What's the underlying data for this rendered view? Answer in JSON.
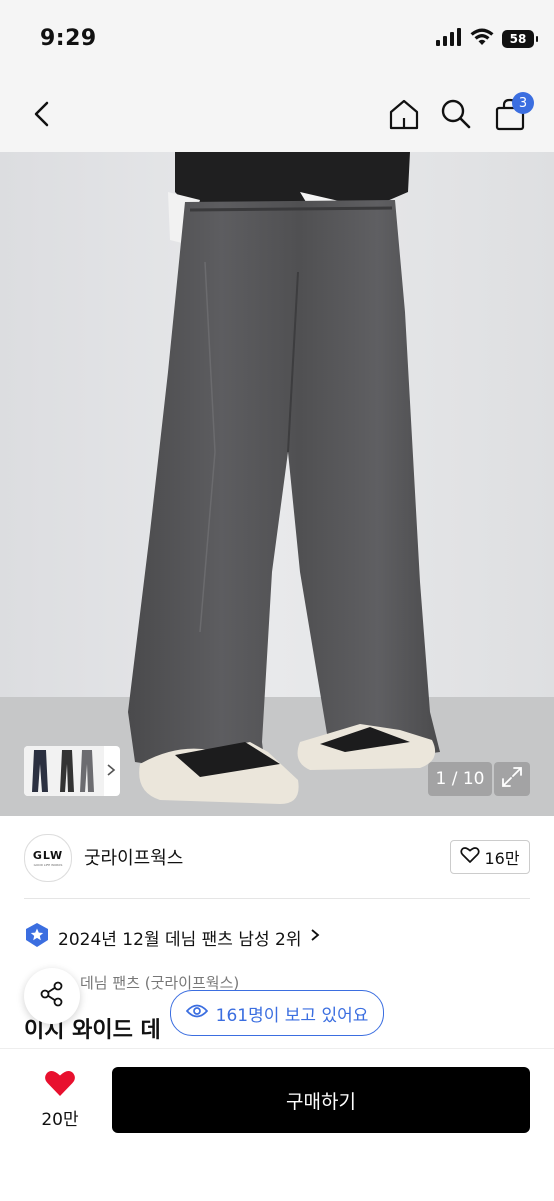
{
  "status": {
    "time": "9:29",
    "battery": "58"
  },
  "nav": {
    "cart_count": "3"
  },
  "gallery": {
    "counter": "1 / 10"
  },
  "brand": {
    "logo_text": "GLW",
    "logo_sub": "GOOD LIFE WORKS",
    "name": "굿라이프웍스",
    "likes": "16만"
  },
  "ranking": {
    "text": "2024년 12월 데님 팬츠 남성 2위"
  },
  "product": {
    "category": "데님 팬츠 (굿라이프웍스)",
    "title_visible": "이지 와이드 데"
  },
  "viewers": {
    "text": "161명이 보고 있어요"
  },
  "bottom": {
    "like_count": "20만",
    "buy_label": "구매하기"
  },
  "colors": {
    "accent": "#3b6ee0",
    "heart": "#e8102e",
    "buy_bg": "#000000"
  }
}
